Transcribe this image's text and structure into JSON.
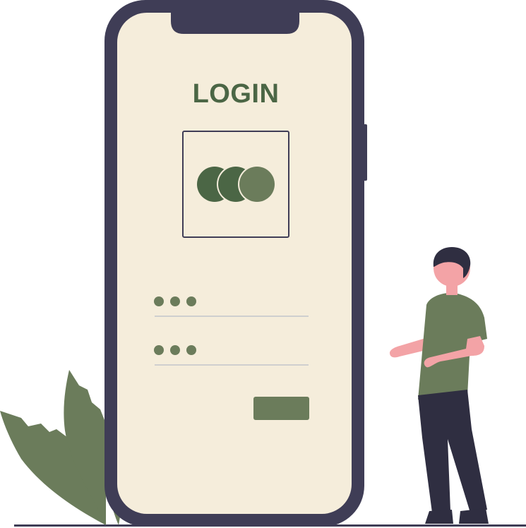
{
  "screen": {
    "title": "LOGIN"
  },
  "icons": {
    "avatar": "three-overlapping-circles-icon",
    "username_dots": "masked-text-dots",
    "password_dots": "masked-text-dots",
    "plant": "leaf-plant",
    "person": "standing-person"
  },
  "colors": {
    "phone_frame": "#3f3d56",
    "screen_bg": "#f5eddb",
    "accent": "#6b7c5b",
    "accent_dark": "#4b6645",
    "title": "#4b6645",
    "divider": "#cfcfcf",
    "skin": "#f3a3a6",
    "pants": "#2f2e41",
    "ground": "#3f3d56"
  }
}
